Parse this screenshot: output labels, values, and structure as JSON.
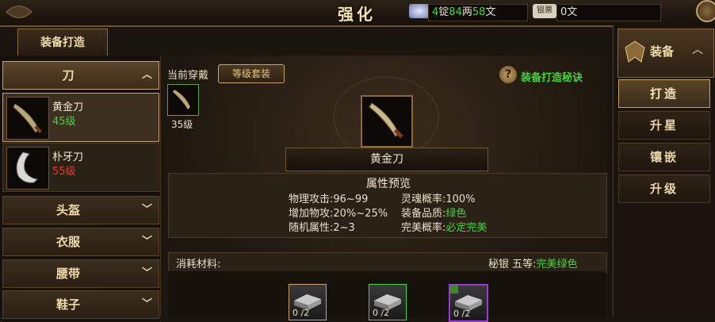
{
  "window": {
    "title": "强化"
  },
  "currency": {
    "silver": {
      "n1": "4",
      "u1": "锭",
      "n2": "84",
      "u2": "两",
      "n3": "58",
      "u3": "文"
    },
    "bound_icon_label": "银票",
    "bound_value": "0文"
  },
  "left": {
    "tab": "装备打造",
    "category_open": "刀",
    "items": [
      {
        "name": "黄金刀",
        "level": "45级",
        "level_color": "#49d13d"
      },
      {
        "name": "朴牙刀",
        "level": "55级",
        "level_color": "#e23c2c"
      }
    ],
    "categories": [
      "头盔",
      "衣服",
      "腰带",
      "鞋子"
    ]
  },
  "center": {
    "wearing_label": "当前穿戴",
    "set_button": "等级套装",
    "tips_link": "装备打造秘诀",
    "worn_level": "35级",
    "item_name": "黄金刀",
    "attr_title": "属性预览",
    "attrs_left": [
      {
        "k": "物理攻击:",
        "v": "96~99"
      },
      {
        "k": "增加物攻:",
        "v": "20%~25%"
      },
      {
        "k": "随机属性:",
        "v": "2~3"
      }
    ],
    "attrs_right": [
      {
        "k": "灵魂概率:",
        "v": "100%",
        "green": false
      },
      {
        "k": "装备品质:",
        "v": "绿色",
        "green": true
      },
      {
        "k": "完美概率:",
        "v": "必定完美",
        "green": true
      }
    ],
    "materials_label": "消耗材料:",
    "materials_info": {
      "prefix": "秘银 五等:",
      "value": "完美绿色"
    },
    "materials": [
      {
        "count": "0 /2",
        "border": "#c9a36a"
      },
      {
        "count": "0 /2",
        "border": "#49d13d"
      },
      {
        "count": "0 /2",
        "border": "#9b3ad8"
      }
    ]
  },
  "right": {
    "header": "装备",
    "buttons": [
      "打造",
      "升星",
      "镶嵌",
      "升级"
    ],
    "selected": 0
  }
}
